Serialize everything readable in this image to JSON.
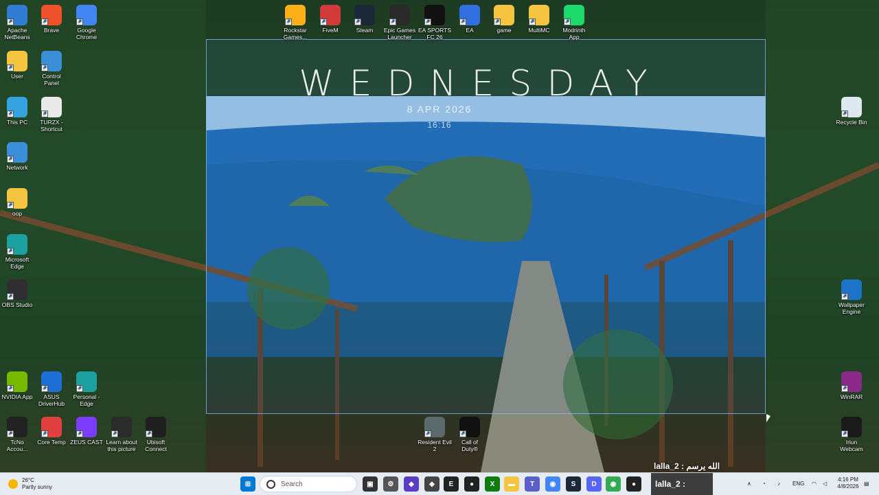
{
  "widget": {
    "day": "WEDNESDAY",
    "date": "8 APR 2026",
    "time": "16:16"
  },
  "desktop_icons": [
    {
      "label": "Apache NetBeans",
      "icon": "netbeans-icon",
      "color": "#2e7dd2"
    },
    {
      "label": "Brave",
      "icon": "brave-icon",
      "color": "#f0512d"
    },
    {
      "label": "Google Chrome",
      "icon": "chrome-icon",
      "color": "#4285f4"
    },
    {
      "label": "Rockstar Games...",
      "icon": "rockstar-icon",
      "color": "#fcaf17"
    },
    {
      "label": "FiveM",
      "icon": "fivem-icon",
      "color": "#d23a3a"
    },
    {
      "label": "Steam",
      "icon": "steam-icon",
      "color": "#1b2838"
    },
    {
      "label": "Epic Games Launcher",
      "icon": "epic-games-icon",
      "color": "#2a2a2a"
    },
    {
      "label": "EA SPORTS FC 26",
      "icon": "ea-fc-icon",
      "color": "#111111"
    },
    {
      "label": "EA",
      "icon": "ea-icon",
      "color": "#2f6fe0"
    },
    {
      "label": "game",
      "icon": "folder-icon",
      "color": "#f5c542"
    },
    {
      "label": "MultiMC",
      "icon": "folder-icon",
      "color": "#f5c542"
    },
    {
      "label": "Modrinth App",
      "icon": "modrinth-icon",
      "color": "#1bd96a"
    },
    {
      "label": "User",
      "icon": "folder-icon",
      "color": "#f5c542"
    },
    {
      "label": "Control Panel",
      "icon": "control-panel-icon",
      "color": "#3a8fd8"
    },
    {
      "label": "This PC",
      "icon": "this-pc-icon",
      "color": "#34a3e0"
    },
    {
      "label": "TURZX - Shortcut",
      "icon": "turzx-icon",
      "color": "#e9e9e9"
    },
    {
      "label": "Network",
      "icon": "network-icon",
      "color": "#3a8fd8"
    },
    {
      "label": "oop",
      "icon": "folder-icon",
      "color": "#f5c542"
    },
    {
      "label": "Microsoft Edge",
      "icon": "edge-icon",
      "color": "#1da1a0"
    },
    {
      "label": "OBS Studio",
      "icon": "obs-icon",
      "color": "#302e31"
    },
    {
      "label": "NVIDIA App",
      "icon": "nvidia-icon",
      "color": "#76b900"
    },
    {
      "label": "ASUS DriverHub",
      "icon": "asus-driverhub-icon",
      "color": "#1d6fd6"
    },
    {
      "label": "Personal - Edge",
      "icon": "edge-icon",
      "color": "#1da1a0"
    },
    {
      "label": "TcNo Accou...",
      "icon": "tcno-icon",
      "color": "#222222"
    },
    {
      "label": "Core Temp",
      "icon": "core-temp-icon",
      "color": "#e04040"
    },
    {
      "label": "ZEUS CAST",
      "icon": "zeus-cast-icon",
      "color": "#7a3cff"
    },
    {
      "label": "Learn about this picture",
      "icon": "learn-picture-icon",
      "color": "#2b2b2b"
    },
    {
      "label": "Ubisoft Connect",
      "icon": "ubisoft-icon",
      "color": "#1f1f1f"
    },
    {
      "label": "Resident Evil 2",
      "icon": "resident-evil-icon",
      "color": "#5a6a6a"
    },
    {
      "label": "Call of Duty®",
      "icon": "call-of-duty-icon",
      "color": "#111111"
    },
    {
      "label": "Recycle Bin",
      "icon": "recycle-bin-icon",
      "color": "#dfe7ef"
    },
    {
      "label": "Wallpaper Engine",
      "icon": "wallpaper-engine-icon",
      "color": "#1e73c8"
    },
    {
      "label": "WinRAR",
      "icon": "winrar-icon",
      "color": "#8b2a8b"
    },
    {
      "label": "Iriun Webcam",
      "icon": "iriun-webcam-icon",
      "color": "#1a1a1a"
    }
  ],
  "overlay_text": "lalla_2 : الله يرسم",
  "taskbar": {
    "weather": {
      "temp": "26°C",
      "condition": "Partly sunny"
    },
    "search_placeholder": "Search",
    "ptt_label": "lalla_2 :",
    "apps": [
      {
        "icon": "start-icon",
        "color": "#0078d4",
        "glyph": "⊞"
      },
      {
        "icon": "task-view-icon",
        "color": "#333333",
        "glyph": "▣"
      },
      {
        "icon": "settings-icon",
        "color": "#555555",
        "glyph": "⚙"
      },
      {
        "icon": "app-icon",
        "color": "#5b3cc4",
        "glyph": "◆"
      },
      {
        "icon": "app-icon",
        "color": "#444444",
        "glyph": "◈"
      },
      {
        "icon": "epic-games-icon",
        "color": "#222222",
        "glyph": "E"
      },
      {
        "icon": "app-icon",
        "color": "#222222",
        "glyph": "●"
      },
      {
        "icon": "xbox-icon",
        "color": "#107c10",
        "glyph": "X"
      },
      {
        "icon": "file-explorer-icon",
        "color": "#f5c542",
        "glyph": "▬"
      },
      {
        "icon": "teams-icon",
        "color": "#5b5fc7",
        "glyph": "T"
      },
      {
        "icon": "chrome-icon",
        "color": "#4285f4",
        "glyph": "◉"
      },
      {
        "icon": "steam-icon",
        "color": "#1b2838",
        "glyph": "S"
      },
      {
        "icon": "discord-icon",
        "color": "#5865f2",
        "glyph": "D"
      },
      {
        "icon": "chrome-icon",
        "color": "#34a853",
        "glyph": "◉"
      },
      {
        "icon": "app-icon",
        "color": "#222222",
        "glyph": "●"
      }
    ],
    "tray": {
      "language": "ENG",
      "time": "4:16 PM",
      "date": "4/8/2026"
    }
  }
}
